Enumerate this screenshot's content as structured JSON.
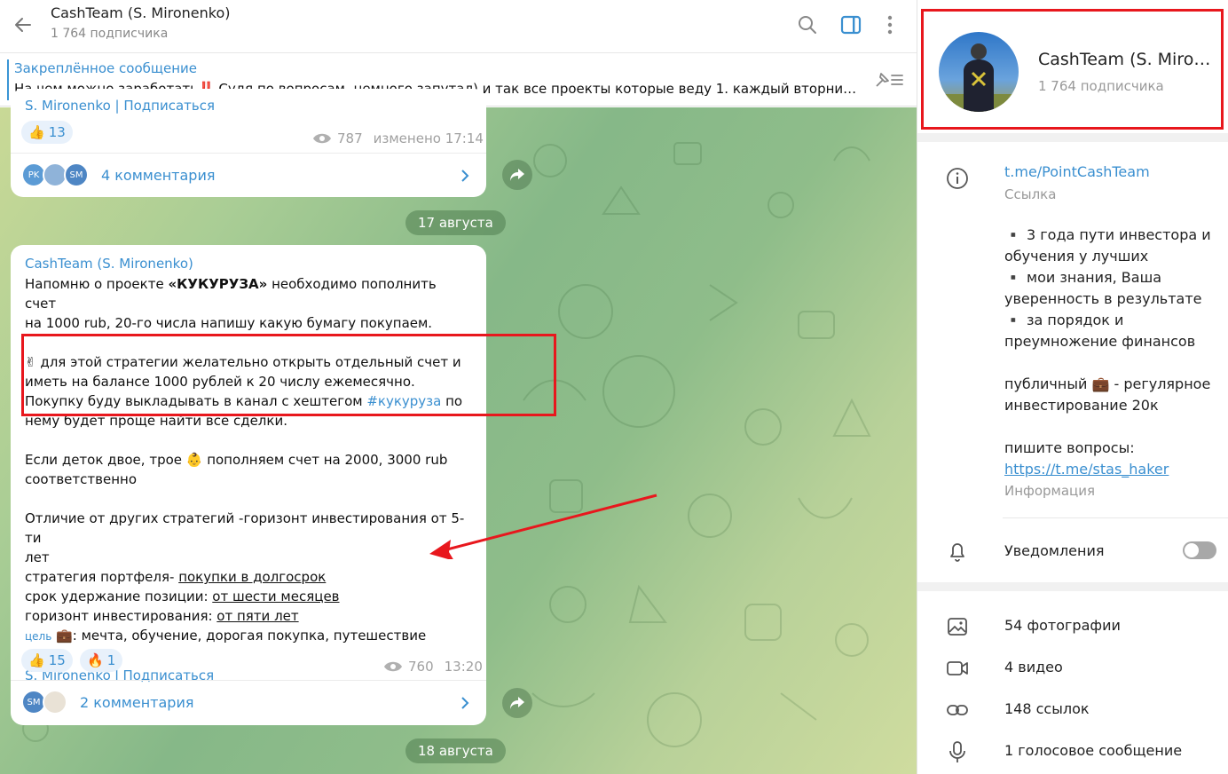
{
  "header": {
    "title": "CashTeam (S. Mironenko)",
    "subscribers": "1 764 подписчика"
  },
  "pinned": {
    "title": "Закреплённое сообщение",
    "text": "На чем можно заработать‼️    Судя по вопросам, немного запутал) и так все проекты которые веду  1. каждый вторни…"
  },
  "msg1": {
    "signature": "S. Mironenko | Подписаться",
    "reaction_emoji": "👍",
    "reaction_count": "13",
    "views": "787",
    "edited": "изменено 17:14",
    "avatar1": "PK",
    "avatar3": "SM",
    "comments": "4 комментария"
  },
  "date1": "17 августа",
  "msg2": {
    "author": "CashTeam (S. Mironenko)",
    "l1a": "Напомню о проекте ",
    "l1b": "«КУКУРУЗА»",
    "l1c": " необходимо пополнить счет",
    "l2": "на 1000 rub, 20-го числа напишу какую бумагу покупаем.",
    "l3": "✌ для этой стратегии желательно открыть отдельный счет и",
    "l4": "иметь на балансе 1000 рублей к 20 числу ежемесячно.",
    "l5a": "Покупку буду выкладывать в канал с хештегом ",
    "l5b": "#кукуруза",
    "l5c": " по",
    "l6": "нему будет проще найти все сделки.",
    "l7": "Если деток двое, трое 👶 пополняем счет на 2000, 3000 rub",
    "l8": "соответственно",
    "l9": "Отличие от других стратегий -горизонт инвестирования от 5-ти",
    "l10": "лет",
    "l11a": "стратегия портфеля- ",
    "l11b": "покупки в долгосрок",
    "l12a": "срок удержание позиции: ",
    "l12b": "от шести месяцев",
    "l13a": "горизонт инвестирования: ",
    "l13b": "от пяти лет",
    "l14a": "цель",
    "l14b": " 💼: мечта, обучение, дорогая покупка, путешествие",
    "signature": "S. Mironenko l Подписаться",
    "r1_emoji": "👍",
    "r1_count": "15",
    "r2_emoji": "🔥",
    "r2_count": "1",
    "views": "760",
    "time": "13:20",
    "avatar1": "SM",
    "comments": "2 комментария"
  },
  "date2": "18 августа",
  "panel": {
    "name": "CashTeam (S. Miro…",
    "subscribers": "1 764 подписчика",
    "link": "t.me/PointCashTeam",
    "link_label": "Ссылка",
    "about": [
      "▪️ 3 года пути инвестора и",
      "обучения у лучших",
      "▪️ мои знания, Ваша",
      "уверенность в результате",
      "▪️ за порядок и",
      "преумножение финансов",
      "",
      "публичный 💼 - регулярное",
      "инвестирование 20к",
      "",
      "пишите вопросы:"
    ],
    "about_link": "https://t.me/stas_haker",
    "info_label": "Информация",
    "notifications": "Уведомления",
    "notifications_on": false,
    "media": [
      {
        "icon": "photo-icon",
        "label": "54 фотографии"
      },
      {
        "icon": "video-icon",
        "label": "4 видео"
      },
      {
        "icon": "link-icon",
        "label": "148 ссылок"
      },
      {
        "icon": "microphone-icon",
        "label": "1 голосовое сообщение"
      }
    ]
  },
  "colors": {
    "accent": "#3a8fd0",
    "annotation_red": "#e8171d"
  }
}
